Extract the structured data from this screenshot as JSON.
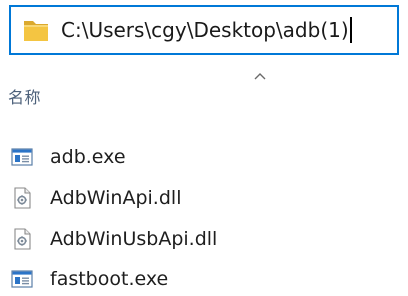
{
  "address_bar": {
    "path": "C:\\Users\\cgy\\Desktop\\adb(1)",
    "icon": "folder-icon"
  },
  "file_list": {
    "column_header": "名称",
    "sort_indicator": "sort-ascending-arrow-icon",
    "items": [
      {
        "name": "adb.exe",
        "icon": "application-exe-icon"
      },
      {
        "name": "AdbWinApi.dll",
        "icon": "dll-file-icon"
      },
      {
        "name": "AdbWinUsbApi.dll",
        "icon": "dll-file-icon"
      },
      {
        "name": "fastboot.exe",
        "icon": "application-exe-icon"
      }
    ]
  },
  "colors": {
    "address_border": "#0078d7",
    "folder_yellow": "#f4c542",
    "header_text": "#4c607a",
    "exe_icon_blue": "#2b74c7"
  }
}
